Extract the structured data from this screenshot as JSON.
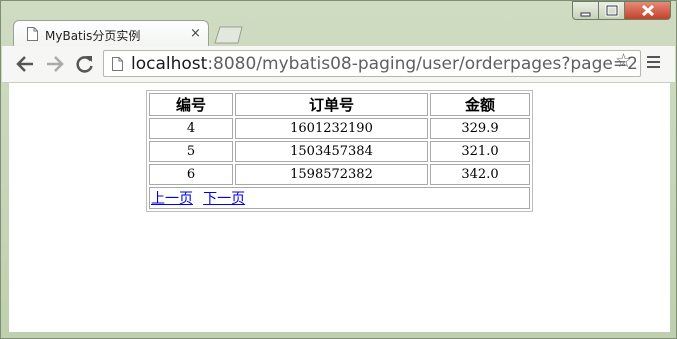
{
  "tab": {
    "title": "MyBatis分页实例",
    "close": "×"
  },
  "address": {
    "host": "localhost",
    "rest": ":8080/mybatis08-paging/user/orderpages?page=2"
  },
  "table": {
    "headers": [
      "编号",
      "订单号",
      "金额"
    ],
    "rows": [
      [
        "4",
        "1601232190",
        "329.9"
      ],
      [
        "5",
        "1503457384",
        "321.0"
      ],
      [
        "6",
        "1598572382",
        "342.0"
      ]
    ]
  },
  "pager": {
    "prev": "上一页",
    "next": "下一页"
  },
  "icons": {
    "back": "back-arrow-icon",
    "forward": "forward-arrow-icon",
    "reload": "reload-icon",
    "star": "star-icon",
    "menu": "hamburger-menu-icon"
  }
}
